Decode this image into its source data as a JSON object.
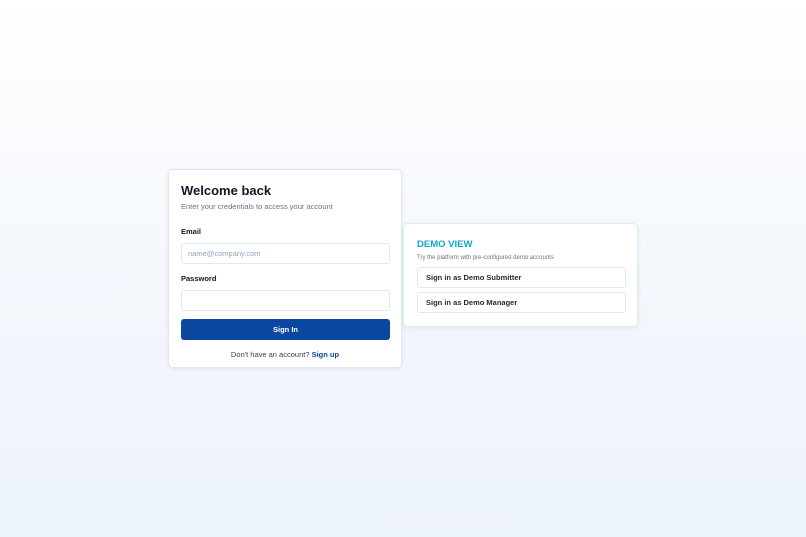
{
  "login": {
    "title": "Welcome back",
    "subtitle": "Enter your credentials to access your account",
    "email_label": "Email",
    "email_value": "",
    "email_placeholder": "name@company.com",
    "password_label": "Password",
    "password_value": "",
    "password_placeholder": "",
    "submit_label": "Sign In",
    "signup_prompt": "Don't have an account?",
    "signup_link": "Sign up"
  },
  "demo": {
    "title": "DEMO VIEW",
    "subtitle": "Try the platform with pre-configured demo accounts",
    "submitter_button": "Sign in as Demo Submitter",
    "manager_button": "Sign in as Demo Manager"
  },
  "colors": {
    "primary": "#0b47a1",
    "demo_accent": "#0ea5c6",
    "muted_text": "#6b7280",
    "background": "#f5f8fd"
  }
}
